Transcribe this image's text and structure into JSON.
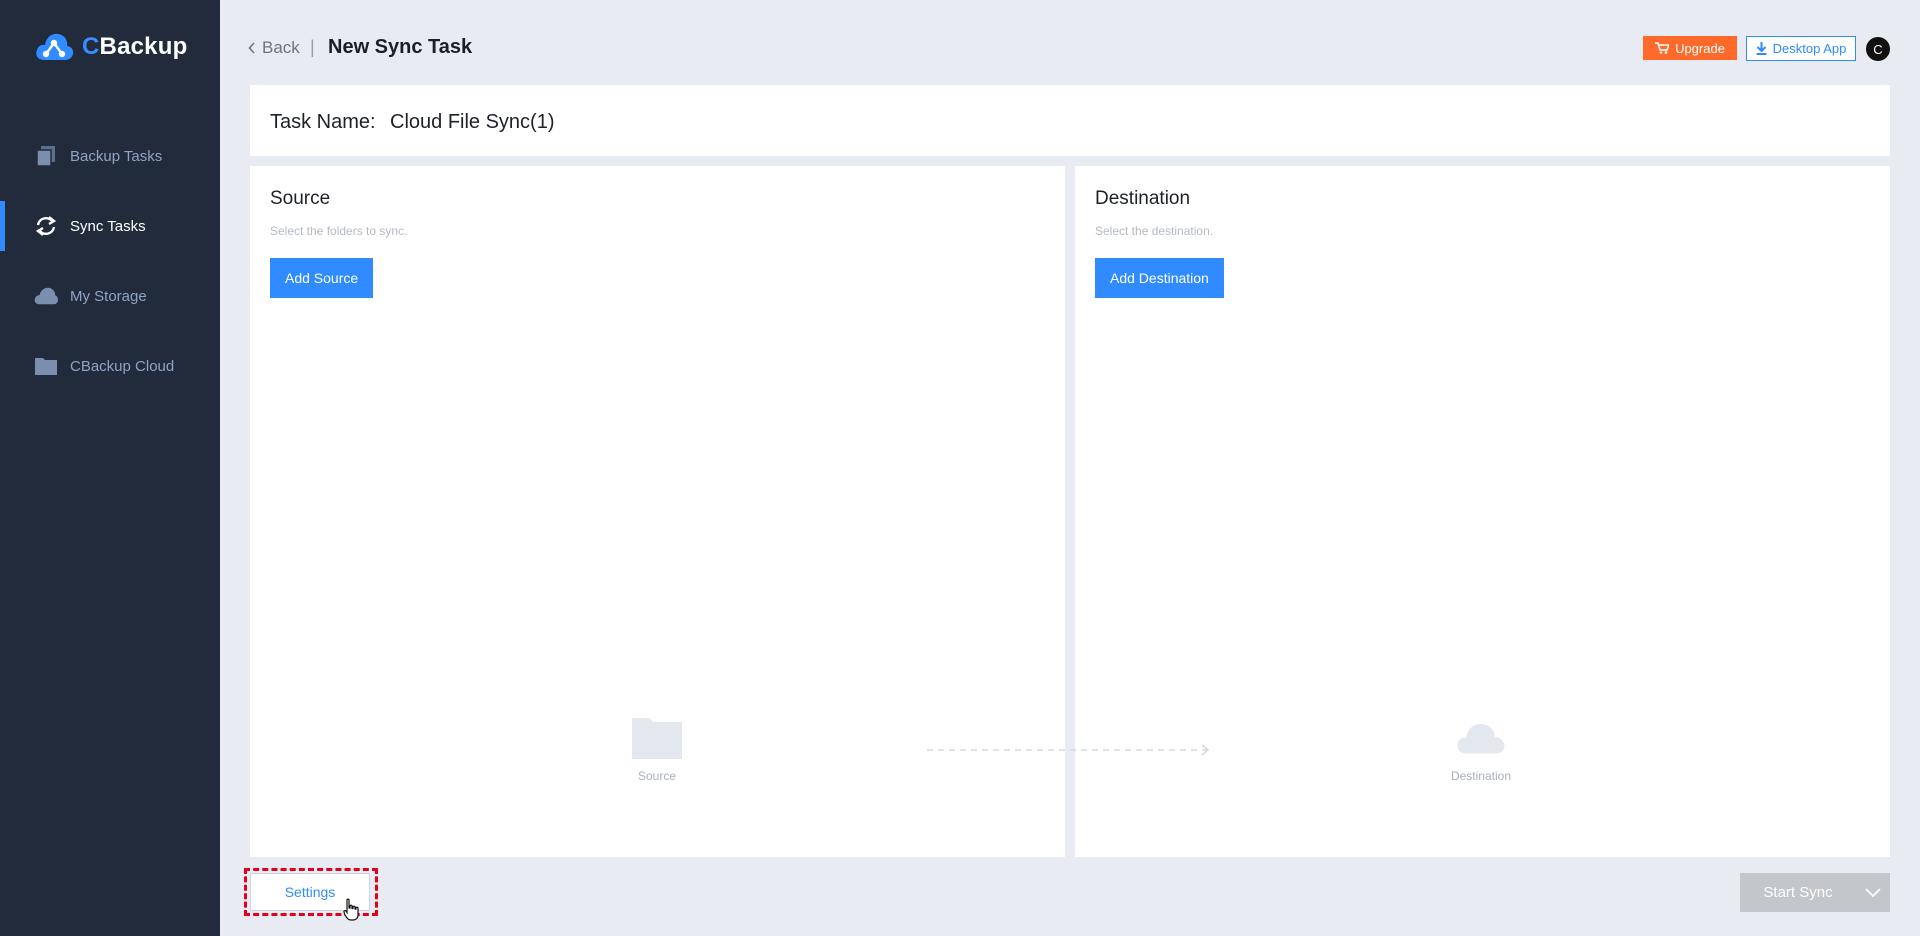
{
  "app": {
    "brand_c": "C",
    "brand_rest": "Backup"
  },
  "sidebar": {
    "items": [
      {
        "label": "Backup Tasks",
        "icon": "backup-tasks-icon",
        "active": false
      },
      {
        "label": "Sync Tasks",
        "icon": "sync-icon",
        "active": true
      },
      {
        "label": "My Storage",
        "icon": "cloud-icon",
        "active": false
      },
      {
        "label": "CBackup Cloud",
        "icon": "folder-icon",
        "active": false
      }
    ]
  },
  "header": {
    "back_label": "Back",
    "separator": "|",
    "title": "New Sync Task",
    "upgrade_label": "Upgrade",
    "desktop_app_label": "Desktop App",
    "avatar_initial": "C"
  },
  "task": {
    "name_label": "Task Name:",
    "name_value": "Cloud File Sync(1)"
  },
  "source": {
    "title": "Source",
    "hint": "Select the folders to sync.",
    "add_label": "Add Source",
    "placeholder_caption": "Source"
  },
  "destination": {
    "title": "Destination",
    "hint": "Select the destination.",
    "add_label": "Add Destination",
    "placeholder_caption": "Destination"
  },
  "footer": {
    "settings_label": "Settings",
    "start_sync_label": "Start Sync"
  },
  "colors": {
    "sidebar_bg": "#222b3b",
    "accent": "#2f8bff",
    "upgrade": "#ff6a2b",
    "highlight_dashed": "#e3001b",
    "disabled": "#c3c6cb"
  }
}
